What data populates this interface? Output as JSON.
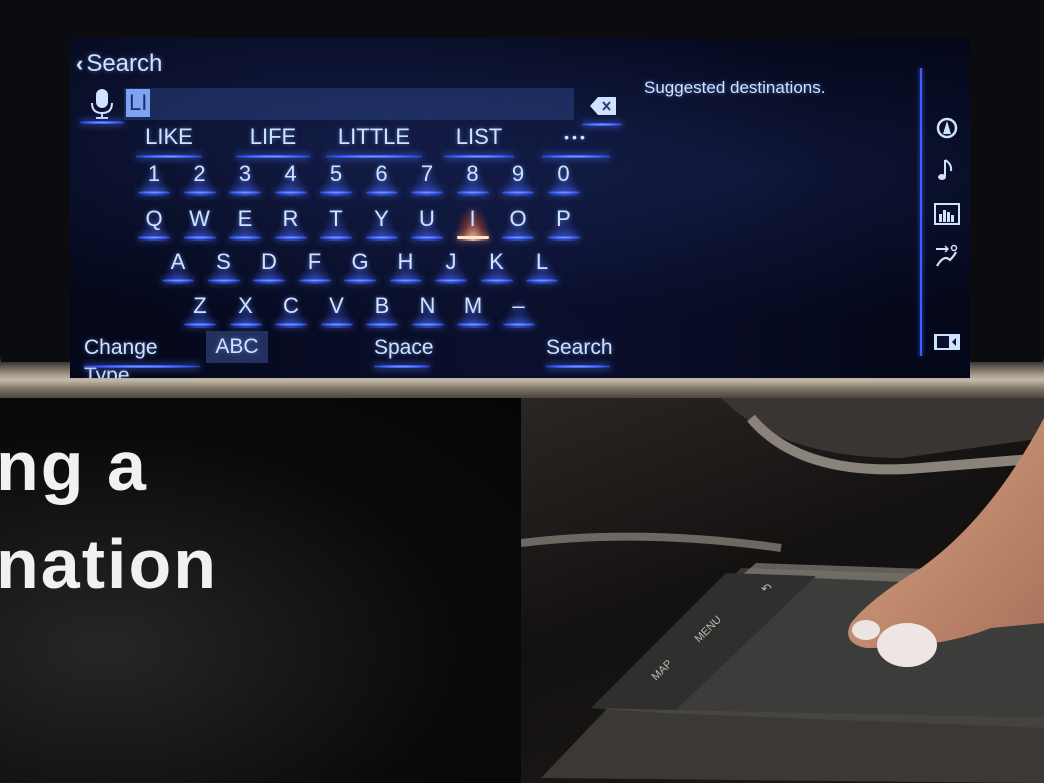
{
  "screen": {
    "header": {
      "back_label": "Search"
    },
    "search_field": {
      "value": "LI"
    },
    "suggestions": [
      "LIKE",
      "LIFE",
      "LITTLE",
      "LIST",
      "•••"
    ],
    "keyboard": {
      "rows": [
        [
          "1",
          "2",
          "3",
          "4",
          "5",
          "6",
          "7",
          "8",
          "9",
          "0"
        ],
        [
          "Q",
          "W",
          "E",
          "R",
          "T",
          "Y",
          "U",
          "I",
          "O",
          "P"
        ],
        [
          "A",
          "S",
          "D",
          "F",
          "G",
          "H",
          "J",
          "K",
          "L"
        ],
        [
          "Z",
          "X",
          "C",
          "V",
          "B",
          "N",
          "M",
          "–"
        ]
      ],
      "highlighted_key": "I"
    },
    "bottom_bar": {
      "change_type_label": "Change Type",
      "type_value": "ABC",
      "space_label": "Space",
      "search_label": "Search"
    },
    "results_panel": {
      "title": "Suggested destinations."
    },
    "side_menu": {
      "icons": [
        "navigation-icon",
        "music-note-icon",
        "equalizer-icon",
        "climate-seat-icon",
        "split-screen-icon"
      ]
    },
    "colors": {
      "accent": "#3e5cff",
      "text": "#cfe2ff",
      "highlight": "#ffcbb0"
    }
  },
  "title_card": {
    "line1": "ng a",
    "line2": "nation"
  },
  "touchpad": {
    "buttons": [
      "MAP",
      "MENU",
      "↶"
    ]
  }
}
